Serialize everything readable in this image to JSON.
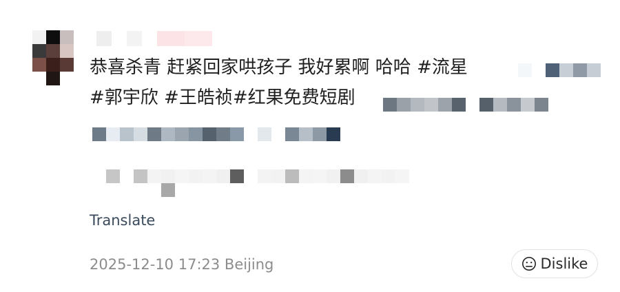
{
  "post": {
    "line1_text": "恭喜杀青 赶紧回家哄孩子 我好累啊 哈哈 ",
    "line1_tag": "#流星",
    "line2_tags": "#郭宇欣 #王皓祯#红果免费短剧"
  },
  "actions": {
    "translate_label": "Translate",
    "timestamp": "2025-12-10 17:23 Beijing",
    "dislike_label": "Dislike"
  },
  "colors": {
    "text": "#1f1f1f",
    "translate": "#3a4a5c",
    "meta": "#8c8c8c",
    "border": "#e2e2e2"
  },
  "icons": {
    "dislike": "frown-face-icon"
  }
}
